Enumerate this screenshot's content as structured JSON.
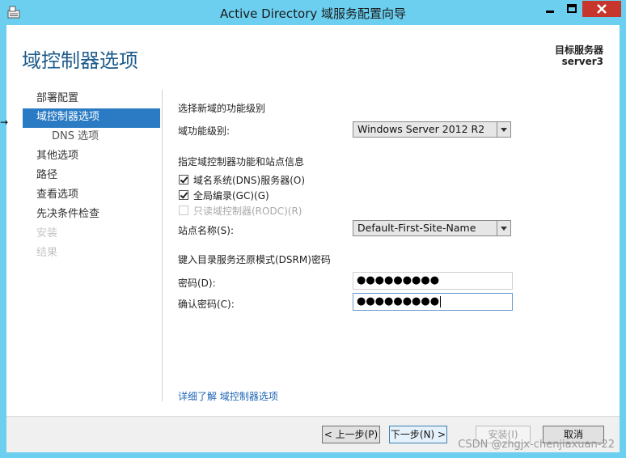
{
  "window": {
    "title": "Active Directory 域服务配置向导",
    "icon": "server-manager-icon",
    "controls": [
      "minimize-icon",
      "maximize-icon",
      "close-icon"
    ],
    "accent": "#6ccff0",
    "close_color": "#c7362c"
  },
  "header": {
    "page_title": "域控制器选项",
    "target_label": "目标服务器",
    "target_server": "server3"
  },
  "nav": {
    "items": [
      {
        "label": "部署配置",
        "state": "normal"
      },
      {
        "label": "域控制器选项",
        "state": "active"
      },
      {
        "label": "DNS 选项",
        "state": "sub"
      },
      {
        "label": "其他选项",
        "state": "normal"
      },
      {
        "label": "路径",
        "state": "normal"
      },
      {
        "label": "查看选项",
        "state": "normal"
      },
      {
        "label": "先决条件检查",
        "state": "normal"
      },
      {
        "label": "安装",
        "state": "disabled"
      },
      {
        "label": "结果",
        "state": "disabled"
      }
    ],
    "active_color": "#2a7bc4"
  },
  "form": {
    "functional_level_heading": "选择新域的功能级别",
    "domain_level_label": "域功能级别:",
    "domain_level_value": "Windows Server 2012 R2",
    "capabilities_heading": "指定域控制器功能和站点信息",
    "checkboxes": [
      {
        "label": "域名系统(DNS)服务器(O)",
        "checked": true,
        "disabled": false
      },
      {
        "label": "全局编录(GC)(G)",
        "checked": true,
        "disabled": false
      },
      {
        "label": "只读域控制器(RODC)(R)",
        "checked": false,
        "disabled": true
      }
    ],
    "site_label": "站点名称(S):",
    "site_value": "Default-First-Site-Name",
    "dsrm_heading": "键入目录服务还原模式(DSRM)密码",
    "password_label": "密码(D):",
    "password_value": "●●●●●●●●●",
    "confirm_label": "确认密码(C):",
    "confirm_value": "●●●●●●●●●",
    "more_link": "详细了解 域控制器选项"
  },
  "footer": {
    "prev_label": "< 上一步(P)",
    "next_label": "下一步(N) >",
    "install_label": "安装(I)",
    "cancel_label": "取消"
  },
  "watermark": "CSDN @zhgjx-chenjiaxuan-22"
}
